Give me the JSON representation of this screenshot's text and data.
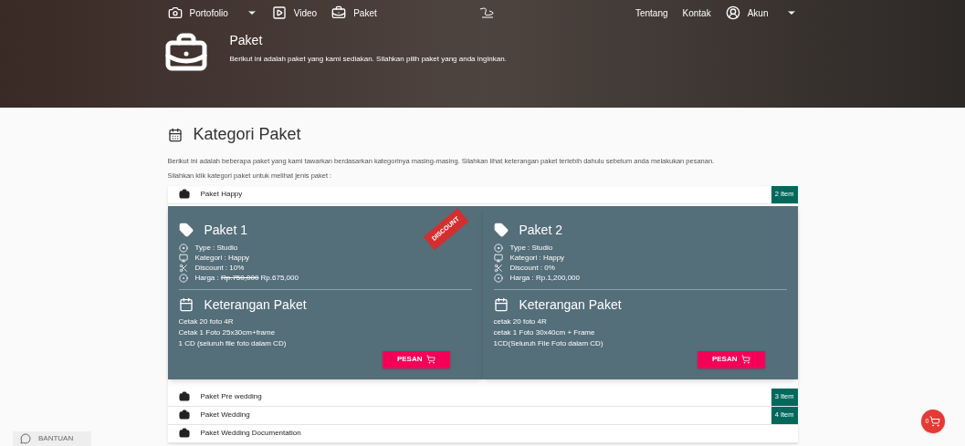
{
  "nav": {
    "left": [
      {
        "label": "Portofolio",
        "kind": "camera",
        "dropdown": true
      },
      {
        "label": "Video",
        "kind": "video",
        "dropdown": false
      },
      {
        "label": "Paket",
        "kind": "briefcase",
        "dropdown": false
      }
    ],
    "right": [
      {
        "label": "Tentang",
        "kind": "link",
        "dropdown": false
      },
      {
        "label": "Kontak",
        "kind": "link",
        "dropdown": false
      },
      {
        "label": "Akun",
        "kind": "account",
        "dropdown": true
      }
    ]
  },
  "hero": {
    "title": "Paket",
    "subtitle": "Berikut ini adalah paket yang kami sediakan. Silahkan pilih paket yang anda inginkan."
  },
  "section": {
    "title": "Kategori Paket",
    "intro": "Berikut ini adalah beberapa paket yang kami tawarkan berdasarkan kategorinya masing-masing. Silahkan lihat keterangan paket terlebih dahulu sebelum anda melakukan pesanan.",
    "hint": "Silahkan klik kategori paket untuk melihat jenis paket :"
  },
  "categories": [
    {
      "name": "Paket Happy",
      "count": "2 Item",
      "packages": [
        {
          "title": "Paket 1",
          "tag": "DISCOUNT",
          "details": [
            {
              "kind": "type",
              "text": "Type : Studio"
            },
            {
              "kind": "category",
              "text": "Kategori : Happy"
            },
            {
              "kind": "discount",
              "text": "Discount : 10%"
            },
            {
              "kind": "price",
              "text": "Harga : ",
              "old_price": "Rp.750,000",
              "price": "Rp.675,000"
            }
          ],
          "info_title": "Keterangan Paket",
          "info": [
            "Cetak 20 foto 4R",
            "Cetak 1 Foto 25x30cm+frame",
            "1 CD (seluruh file foto dalam CD)"
          ],
          "button": "PESAN"
        },
        {
          "title": "Paket 2",
          "details": [
            {
              "kind": "type",
              "text": "Type : Studio"
            },
            {
              "kind": "category",
              "text": "Kategori : Happy"
            },
            {
              "kind": "discount",
              "text": "Discount : 0%"
            },
            {
              "kind": "price",
              "text": "Harga : Rp.1,200,000"
            }
          ],
          "info_title": "Keterangan Paket",
          "info": [
            "cetak 20 foto 4R",
            "cetak 1 Foto 30x40cm + Frame",
            "1CD(Seluruh File Foto dalam CD)"
          ],
          "button": "PESAN"
        }
      ]
    },
    {
      "name": "Paket Pre wedding",
      "count": "3 Item"
    },
    {
      "name": "Paket Wedding",
      "count": "4 Item"
    },
    {
      "name": "Paket Wedding Documentation"
    }
  ],
  "help": {
    "label": "BANTUAN"
  },
  "cart": {
    "count": "0"
  }
}
